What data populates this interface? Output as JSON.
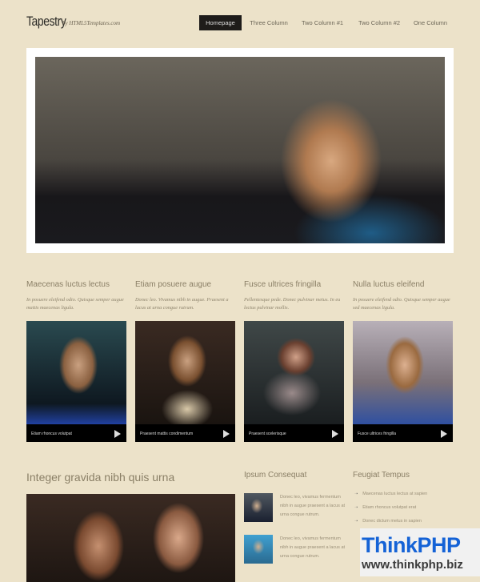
{
  "header": {
    "logo": "Tapestry",
    "byline": "by HTML5Templates.com"
  },
  "nav": [
    "Homepage",
    "Three Column",
    "Two Column #1",
    "Two Column #2",
    "One Column"
  ],
  "columns": [
    {
      "title": "Maecenas luctus lectus",
      "text": "In posuere eleifend odio. Quisque semper augue mattis maecenas ligula.",
      "caption": "Etiam rhoncus volutpat"
    },
    {
      "title": "Etiam posuere augue",
      "text": "Donec leo. Vivamus nibh in augue. Praesent a lacus at urna congue rutrum.",
      "caption": "Praesent mattis condimentum"
    },
    {
      "title": "Fusce ultrices fringilla",
      "text": "Pellentesque pede. Donec pulvinar metus. In eu lectus pulvinar mollis.",
      "caption": "Praesent scelerisque"
    },
    {
      "title": "Nulla luctus eleifend",
      "text": "In posuere eleifend odio. Quisque semper augue sed maecenas ligula.",
      "caption": "Fusce ultrices fringilla"
    }
  ],
  "feature": {
    "title": "Integer gravida nibh quis urna"
  },
  "sidebar1": {
    "title": "Ipsum Consequat",
    "items": [
      "Donec leo, vivamus fermentum nibh in augue praesent a lacus at urna congue rutrum.",
      "Donec leo, vivamus fermentum nibh in augue praesent a lacus at urna congue rutrum."
    ]
  },
  "sidebar2": {
    "title": "Feugiat Tempus",
    "items": [
      "Maecenas luctus lectus at sapien",
      "Etiam rhoncus volutpat erat",
      "Donec dictum metus in sapien"
    ]
  },
  "watermark": {
    "brand": "ThinkPHP",
    "url": "www.thinkphp.biz"
  }
}
